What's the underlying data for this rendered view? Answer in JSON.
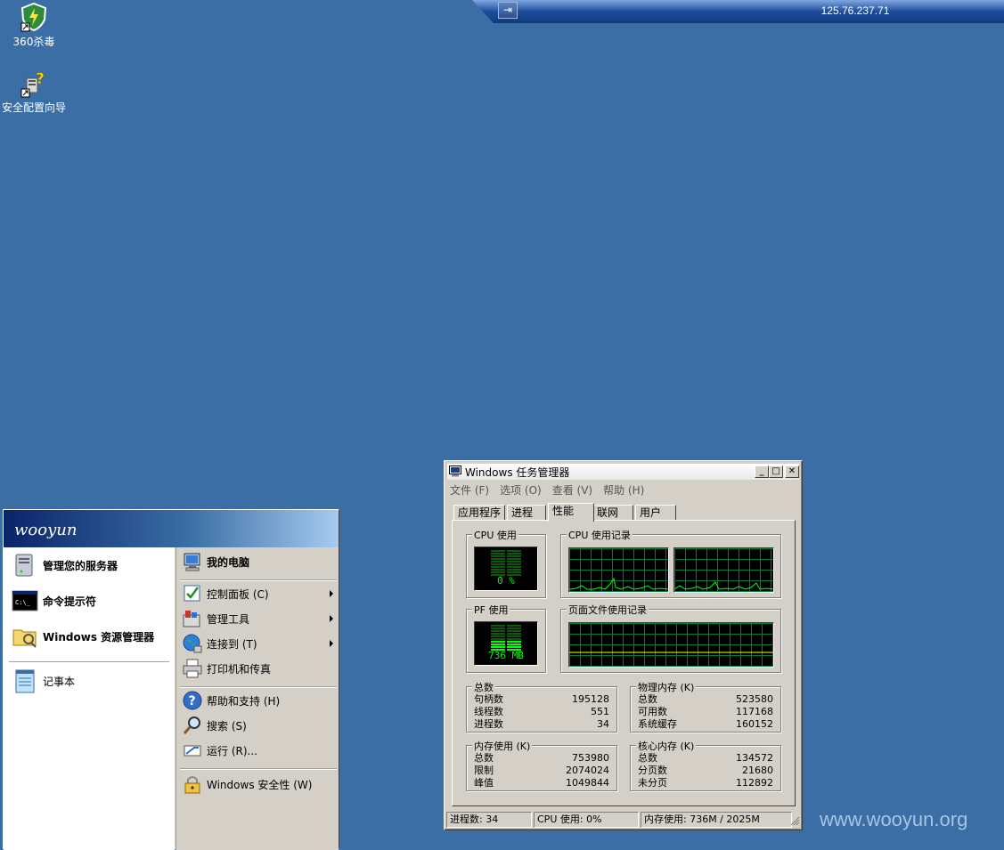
{
  "rdp_bar": {
    "ip": "125.76.237.71",
    "pin_icon": "pin-icon"
  },
  "desktop_icons": [
    {
      "label": "360杀毒",
      "icon": "shield-icon"
    },
    {
      "label": "安全配置向导",
      "icon": "security-wizard-icon"
    }
  ],
  "watermark": "www.wooyun.org",
  "start_menu": {
    "user": "wooyun",
    "left_items": [
      {
        "label": "管理您的服务器",
        "icon": "server-icon"
      },
      {
        "label": "命令提示符",
        "icon": "cmd-icon"
      },
      {
        "label": "Windows 资源管理器",
        "icon": "explorer-icon"
      },
      {
        "label": "记事本",
        "icon": "notepad-icon"
      }
    ],
    "right_items": [
      {
        "label": "我的电脑",
        "icon": "my-computer-icon"
      },
      {
        "label": "控制面板 (C)",
        "icon": "control-panel-icon"
      },
      {
        "label": "管理工具",
        "icon": "admin-tools-icon"
      },
      {
        "label": "连接到 (T)",
        "icon": "connect-icon"
      },
      {
        "label": "打印机和传真",
        "icon": "printer-icon"
      },
      {
        "label": "帮助和支持 (H)",
        "icon": "help-icon"
      },
      {
        "label": "搜索 (S)",
        "icon": "search-icon"
      },
      {
        "label": "运行 (R)...",
        "icon": "run-icon"
      },
      {
        "label": "Windows 安全性 (W)",
        "icon": "lock-icon"
      }
    ]
  },
  "task_manager": {
    "title": "Windows 任务管理器",
    "menu": [
      "文件 (F)",
      "选项 (O)",
      "查看 (V)",
      "帮助 (H)"
    ],
    "tabs": [
      "应用程序",
      "进程",
      "性能",
      "联网",
      "用户"
    ],
    "active_tab": "性能",
    "cpu_usage": {
      "title": "CPU 使用",
      "value": "0 %"
    },
    "cpu_history": {
      "title": "CPU 使用记录"
    },
    "pf_usage": {
      "title": "PF 使用",
      "value": "736 MB"
    },
    "pf_history": {
      "title": "页面文件使用记录"
    },
    "totals": {
      "title": "总数",
      "rows": [
        {
          "label": "句柄数",
          "value": "195128"
        },
        {
          "label": "线程数",
          "value": "551"
        },
        {
          "label": "进程数",
          "value": "34"
        }
      ]
    },
    "physical_memory": {
      "title": "物理内存 (K)",
      "rows": [
        {
          "label": "总数",
          "value": "523580"
        },
        {
          "label": "可用数",
          "value": "117168"
        },
        {
          "label": "系统缓存",
          "value": "160152"
        }
      ]
    },
    "commit_charge": {
      "title": "内存使用 (K)",
      "rows": [
        {
          "label": "总数",
          "value": "753980"
        },
        {
          "label": "限制",
          "value": "2074024"
        },
        {
          "label": "峰值",
          "value": "1049844"
        }
      ]
    },
    "kernel_memory": {
      "title": "核心内存 (K)",
      "rows": [
        {
          "label": "总数",
          "value": "134572"
        },
        {
          "label": "分页数",
          "value": "21680"
        },
        {
          "label": "未分页",
          "value": "112892"
        }
      ]
    },
    "status": {
      "processes": "进程数: 34",
      "cpu": "CPU 使用: 0%",
      "memory": "内存使用: 736M / 2025M"
    }
  }
}
